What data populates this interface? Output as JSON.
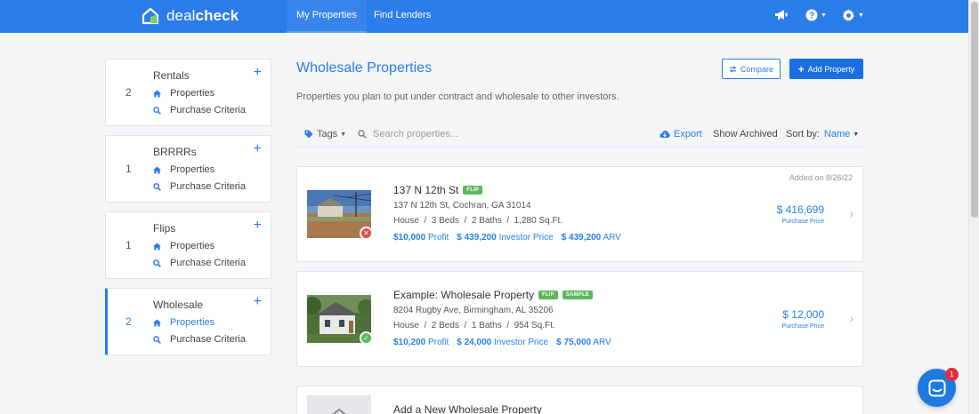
{
  "brand": {
    "name_light": "deal",
    "name_bold": "check"
  },
  "nav": {
    "my_properties": "My Properties",
    "find_lenders": "Find Lenders"
  },
  "sidebar": {
    "items": [
      {
        "title": "Rentals",
        "count": "2",
        "link1": "Properties",
        "link2": "Purchase Criteria"
      },
      {
        "title": "BRRRRs",
        "count": "1",
        "link1": "Properties",
        "link2": "Purchase Criteria"
      },
      {
        "title": "Flips",
        "count": "1",
        "link1": "Properties",
        "link2": "Purchase Criteria"
      },
      {
        "title": "Wholesale",
        "count": "2",
        "link1": "Properties",
        "link2": "Purchase Criteria"
      }
    ],
    "plus": "+"
  },
  "page": {
    "title": "Wholesale Properties",
    "subtitle": "Properties you plan to put under contract and wholesale to other investors.",
    "compare_label": "Compare",
    "add_label": "Add Property"
  },
  "toolbar": {
    "tags": "Tags",
    "search_placeholder": "Search properties...",
    "export": "Export",
    "show_archived": "Show Archived",
    "sort_label": "Sort by:",
    "sort_value": "Name"
  },
  "properties": [
    {
      "name": "137 N 12th St",
      "badges": [
        "FLIP"
      ],
      "address": "137 N 12th St, Cochran, GA 31014",
      "specs": "House  /  3 Beds  /  2 Baths  /  1,280 Sq.Ft.",
      "profit_value": "$10,000",
      "profit_label": "Profit",
      "investor_value": "$ 439,200",
      "investor_label": "Investor Price",
      "arv_value": "$ 439,200",
      "arv_label": "ARV",
      "added": "Added on 8/26/22",
      "price": "$ 416,699",
      "price_label": "Purchase Price",
      "status": "fail"
    },
    {
      "name": "Example: Wholesale Property",
      "badges": [
        "FLIP",
        "SAMPLE"
      ],
      "address": "8204 Rugby Ave, Birmingham, AL 35206",
      "specs": "House  /  2 Beds  /  1 Baths  /  954 Sq.Ft.",
      "profit_value": "$10,200",
      "profit_label": "Profit",
      "investor_value": "$ 24,000",
      "investor_label": "Investor Price",
      "arv_value": "$ 75,000",
      "arv_label": "ARV",
      "added": "",
      "price": "$ 12,000",
      "price_label": "Purchase Price",
      "status": "pass"
    }
  ],
  "add_new": {
    "label": "Add a New Wholesale Property"
  },
  "chat": {
    "badge_count": "1"
  },
  "colors": {
    "primary": "#2b7de9",
    "badge_green": "#5cb85c",
    "fail_red": "#e04a4a",
    "pass_green": "#5cb85c"
  }
}
